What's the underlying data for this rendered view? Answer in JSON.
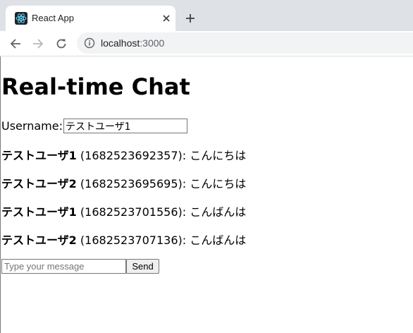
{
  "browser": {
    "tab_title": "React App",
    "url_host": "localhost",
    "url_port": ":3000"
  },
  "page": {
    "title": "Real-time Chat",
    "username_label": "Username:",
    "username_value": "テストユーザ1",
    "messages": [
      {
        "user": "テストユーザ1",
        "meta": " (1682523692357): ",
        "text": "こんにちは"
      },
      {
        "user": "テストユーザ2",
        "meta": " (1682523695695): ",
        "text": "こんにちは"
      },
      {
        "user": "テストユーザ1",
        "meta": " (1682523701556): ",
        "text": "こんばんは"
      },
      {
        "user": "テストユーザ2",
        "meta": " (1682523707136): ",
        "text": "こんばんは"
      }
    ],
    "message_placeholder": "Type your message",
    "send_label": "Send"
  },
  "colors": {
    "tabstrip": "#dee1e6",
    "react_logo": "#61dafb",
    "react_bg": "#20232a"
  },
  "icons": [
    "react-favicon",
    "close-icon",
    "plus-icon",
    "back-arrow-icon",
    "forward-arrow-icon",
    "reload-icon",
    "info-icon"
  ]
}
